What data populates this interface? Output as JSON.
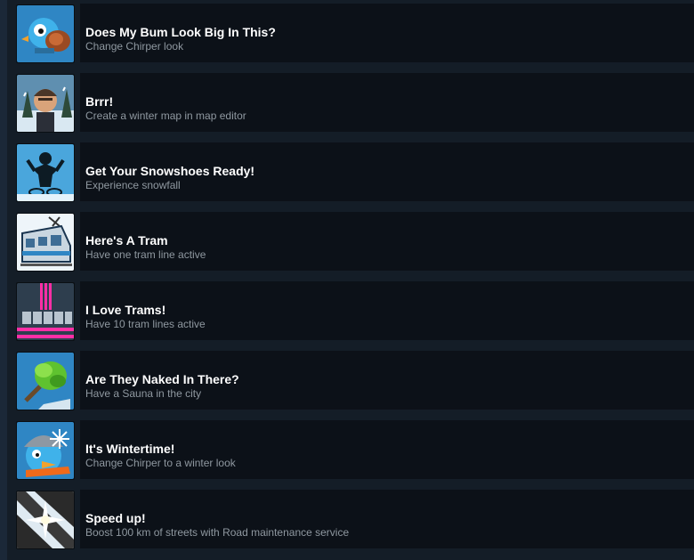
{
  "achievements": [
    {
      "title": "Does My Bum Look Big In This?",
      "desc": "Change Chirper look",
      "icon": "chirper-bird-icon"
    },
    {
      "title": "Brrr!",
      "desc": "Create a winter map in map editor",
      "icon": "cold-man-icon"
    },
    {
      "title": "Get Your Snowshoes Ready!",
      "desc": "Experience snowfall",
      "icon": "snowshoes-icon"
    },
    {
      "title": "Here's A Tram",
      "desc": "Have one tram line active",
      "icon": "tram-icon"
    },
    {
      "title": "I Love Trams!",
      "desc": "Have 10 tram lines active",
      "icon": "tram-lines-icon"
    },
    {
      "title": "Are They Naked In There?",
      "desc": "Have a Sauna in the city",
      "icon": "sauna-whisk-icon"
    },
    {
      "title": "It's Wintertime!",
      "desc": "Change Chirper to a winter look",
      "icon": "winter-chirper-icon"
    },
    {
      "title": "Speed up!",
      "desc": "Boost 100 km of streets with Road maintenance service",
      "icon": "road-sparkle-icon"
    }
  ],
  "colors": {
    "background": "#1b2838",
    "panel": "#0c1118",
    "title": "#ffffff",
    "description": "#8f98a0",
    "icon_blue": "#2f86c4"
  }
}
